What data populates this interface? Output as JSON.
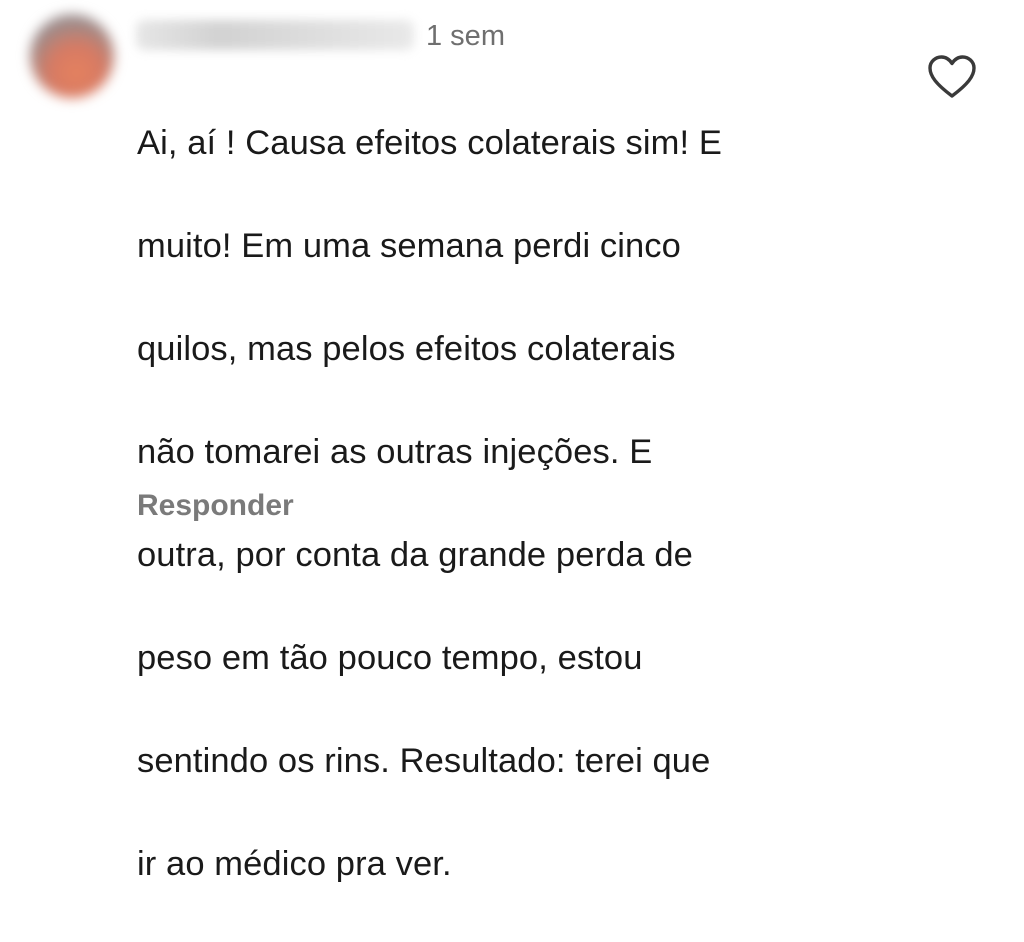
{
  "comment": {
    "timestamp": "1 sem",
    "lines": [
      "Ai, aí ! Causa efeitos colaterais sim! E",
      "muito! Em uma semana perdi cinco",
      "quilos, mas pelos efeitos colaterais",
      "não tomarei as outras injeções. E",
      "outra, por conta da grande perda de",
      "peso em tão pouco tempo, estou",
      "sentindo os rins.  Resultado: terei que",
      "ir ao médico pra ver."
    ],
    "reply_label": "Responder",
    "like_icon": "heart-outline-icon"
  }
}
